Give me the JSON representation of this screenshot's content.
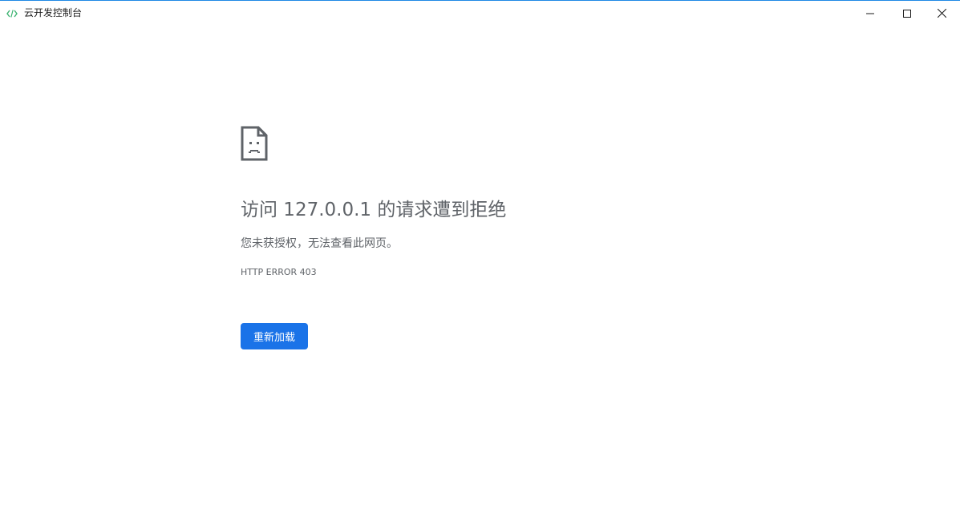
{
  "window": {
    "title": "云开发控制台",
    "app_icon": "code-brackets-icon",
    "controls": [
      "minimize-icon",
      "maximize-icon",
      "close-icon"
    ]
  },
  "error_page": {
    "icon": "sad-document-icon",
    "heading": "访问 127.0.0.1 的请求遭到拒绝",
    "description": "您未获授权，无法查看此网页。",
    "error_code": "HTTP ERROR 403",
    "reload_label": "重新加载"
  },
  "colors": {
    "accent": "#1a73e8",
    "text_secondary": "#5f6368",
    "titlebar_border": "#1e88e5",
    "app_icon_green": "#3cb371"
  }
}
